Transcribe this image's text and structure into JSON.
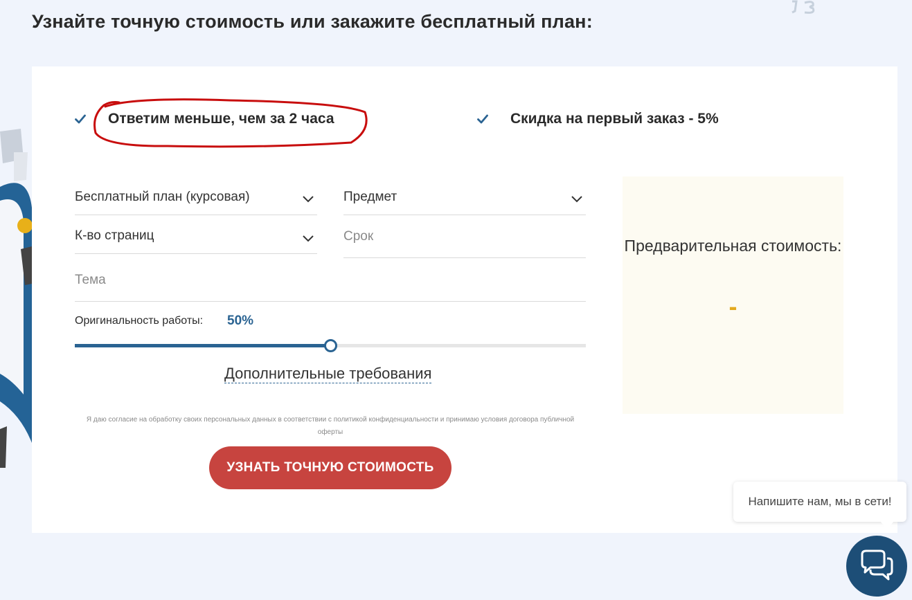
{
  "page": {
    "title": "Узнайте точную стоимость или закажите бесплатный план:"
  },
  "features": [
    {
      "text": "Ответим меньше, чем за 2 часа"
    },
    {
      "text": "Скидка на первый заказ - 5%"
    }
  ],
  "form": {
    "work_type": {
      "value": "Бесплатный план (курсовая)"
    },
    "subject": {
      "value": "Предмет"
    },
    "pages": {
      "value": "К-во страниц"
    },
    "deadline": {
      "placeholder": "Срок"
    },
    "topic": {
      "placeholder": "Тема"
    },
    "originality": {
      "label": "Оригинальность работы:",
      "value_text": "50%",
      "value": 0.5
    },
    "extra_requirements": "Дополнительные требования",
    "consent": "Я даю согласие на обработку своих персональных данных в соответствии с политикой конфиденциальности и принимаю условия договора публичной оферты",
    "submit_label": "УЗНАТЬ ТОЧНУЮ СТОИМОСТЬ"
  },
  "price": {
    "label": "Предварительная стоимость:",
    "value": "-"
  },
  "chat": {
    "bubble_text": "Напишите нам, мы в сети!"
  },
  "colors": {
    "accent": "#2a6392",
    "button": "#c7443f",
    "price_value": "#e3a91f",
    "highlight_ring": "#c80d0d",
    "chat_button": "#1d4e77"
  }
}
